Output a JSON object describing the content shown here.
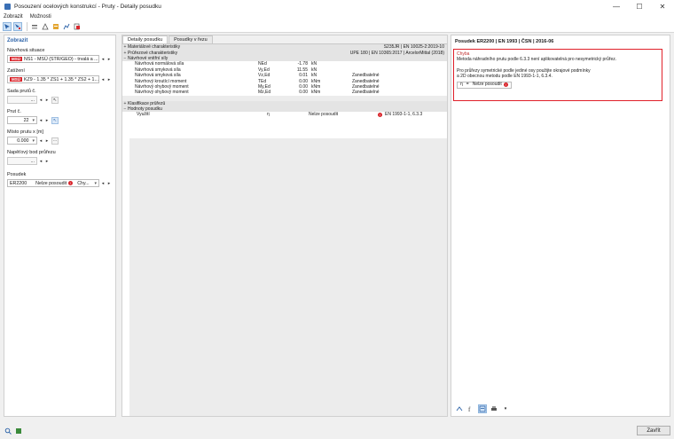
{
  "window": {
    "title": "Posouzení ocelových konstrukcí - Pruty - Detaily posudku",
    "minimize": "—",
    "maximize": "☐",
    "close": "✕"
  },
  "menu": [
    "Zobrazit",
    "Možnosti"
  ],
  "left": {
    "header": "Zobrazit",
    "design_situation_label": "Návrhová situace",
    "design_situation_badge": "MSÚ",
    "design_situation_value": "NS1 - MSÚ (STR/GEO) - trvalá a ...",
    "loading_label": "Zatížení",
    "loading_badge": "MSÚ",
    "loading_value": "KZ9 - 1.35 * ZS1 + 1.35 * ZS2 + 1...",
    "member_set_label": "Sada prutů č.",
    "member_set_value": "...",
    "member_label": "Prut č.",
    "member_value": "22",
    "location_label": "Místo prutu x [m]",
    "location_value": "0.000",
    "stress_point_label": "Napěťový bod průřezu",
    "stress_point_value": "...",
    "check_label": "Posudek",
    "check_code": "ER2200",
    "check_status": "Nelze posoudit",
    "check_result": "Chy..."
  },
  "center": {
    "tabs": [
      "Detaily posudku",
      "Posudky v řezu"
    ],
    "rows": [
      {
        "indent": 0,
        "tog": "+",
        "name": "Materiálové charakteristiky",
        "sym": "",
        "val": "",
        "unit": "",
        "note": "S235JR | EN 10025-2:2019-10",
        "kind": "group"
      },
      {
        "indent": 0,
        "tog": "+",
        "name": "Průřezové charakteristiky",
        "sym": "",
        "val": "",
        "unit": "",
        "note": "UPE 180 | EN 10365:2017 | ArcelorMittal (2018)",
        "kind": "group"
      },
      {
        "indent": 0,
        "tog": "−",
        "name": "Návrhové vnitřní síly",
        "sym": "",
        "val": "",
        "unit": "",
        "note": "",
        "kind": "group"
      },
      {
        "indent": 1,
        "tog": "",
        "name": "Návrhová normálová síla",
        "sym": "NEd",
        "val": "-1.78",
        "unit": "kN",
        "note": "",
        "kind": "row"
      },
      {
        "indent": 1,
        "tog": "",
        "name": "Návrhová smyková síla",
        "sym": "Vy,Ed",
        "val": "11.55",
        "unit": "kN",
        "note": "",
        "kind": "row"
      },
      {
        "indent": 1,
        "tog": "",
        "name": "Návrhová smyková síla",
        "sym": "Vz,Ed",
        "val": "0.01",
        "unit": "kN",
        "note": "Zanedbatelné",
        "kind": "row"
      },
      {
        "indent": 1,
        "tog": "",
        "name": "Návrhový kroutící moment",
        "sym": "TEd",
        "val": "0.00",
        "unit": "kNm",
        "note": "Zanedbatelné",
        "kind": "row"
      },
      {
        "indent": 1,
        "tog": "",
        "name": "Návrhový ohybový moment",
        "sym": "My,Ed",
        "val": "0.00",
        "unit": "kNm",
        "note": "Zanedbatelné",
        "kind": "row"
      },
      {
        "indent": 1,
        "tog": "",
        "name": "Návrhový ohybový moment",
        "sym": "Mz,Ed",
        "val": "0.00",
        "unit": "kNm",
        "note": "Zanedbatelné",
        "kind": "row"
      }
    ],
    "rows2": [
      {
        "tog": "+",
        "name": "Klasifikace průřezů",
        "kind": "group"
      },
      {
        "tog": "−",
        "name": "Hodnoty posudku",
        "kind": "group"
      }
    ],
    "util_row": {
      "name": "Využití",
      "sym": "η",
      "val": "Nelze posoudit",
      "note": "EN 1993-1-1, 6.3.3"
    }
  },
  "right": {
    "title": "Posudek ER2200 | EN 1993 | ČSN | 2016-06",
    "err_head": "Chyba",
    "err_line1": "Metoda náhradního prutu podle 6.3.3 není aplikovatelná pro nesymetrický průřez.",
    "err_line2": "Pro průřezy symetrické podle jediné osy použijte okrajové podmínky",
    "err_line3": "a 2D obecnou metodu podle EN 1993-1-1, 6.3.4.",
    "chip_sym": "η",
    "chip_eq": "=",
    "chip_text": "Nelze posoudit"
  },
  "footer": {
    "close_label": "Zavřít"
  }
}
